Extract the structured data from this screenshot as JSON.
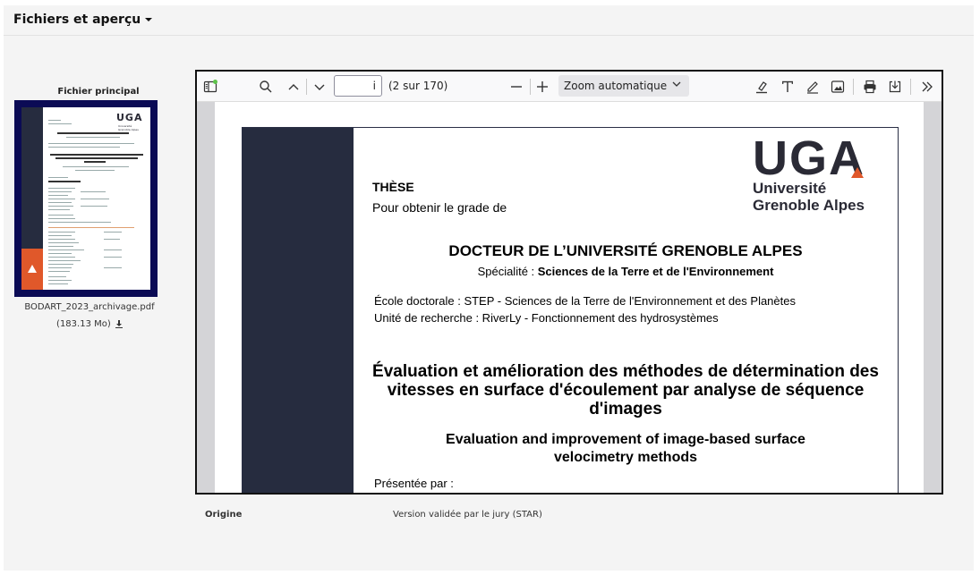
{
  "section": {
    "title": "Fichiers et aperçu"
  },
  "file": {
    "label": "Fichier principal",
    "name": "BODART_2023_archivage.pdf",
    "size": "(183.13 Mo)"
  },
  "viewer": {
    "page_value": "i",
    "page_count": "(2 sur 170)",
    "zoom": "Zoom automatique"
  },
  "document": {
    "logo_text": "UGA",
    "logo_line1": "Université",
    "logo_line2": "Grenoble Alpes",
    "these": "THÈSE",
    "pour_obtenir": "Pour obtenir le grade de",
    "docteur": "DOCTEUR DE L’UNIVERSITÉ GRENOBLE ALPES",
    "specialite_label": "Spécialité : ",
    "specialite_value": "Sciences de la Terre et de l'Environnement",
    "ecole": "École doctorale : STEP - Sciences de la Terre de l'Environnement et des Planètes",
    "unite": "Unité de recherche : RiverLy - Fonctionnement des hydrosystèmes",
    "title_fr_1": "Évaluation et amélioration des méthodes de détermination des",
    "title_fr_2": "vitesses en surface d'écoulement par analyse de séquence",
    "title_fr_3": "d'images",
    "title_en_1": "Evaluation and improvement of image-based surface",
    "title_en_2": "velocimetry methods",
    "presentee": "Présentée par :"
  },
  "origin": {
    "label": "Origine",
    "value": "Version validée par le jury (STAR)"
  },
  "colors": {
    "accent_orange": "#e0582a",
    "dark_navy": "#262c3f",
    "thumb_frame": "#0b0b55"
  }
}
